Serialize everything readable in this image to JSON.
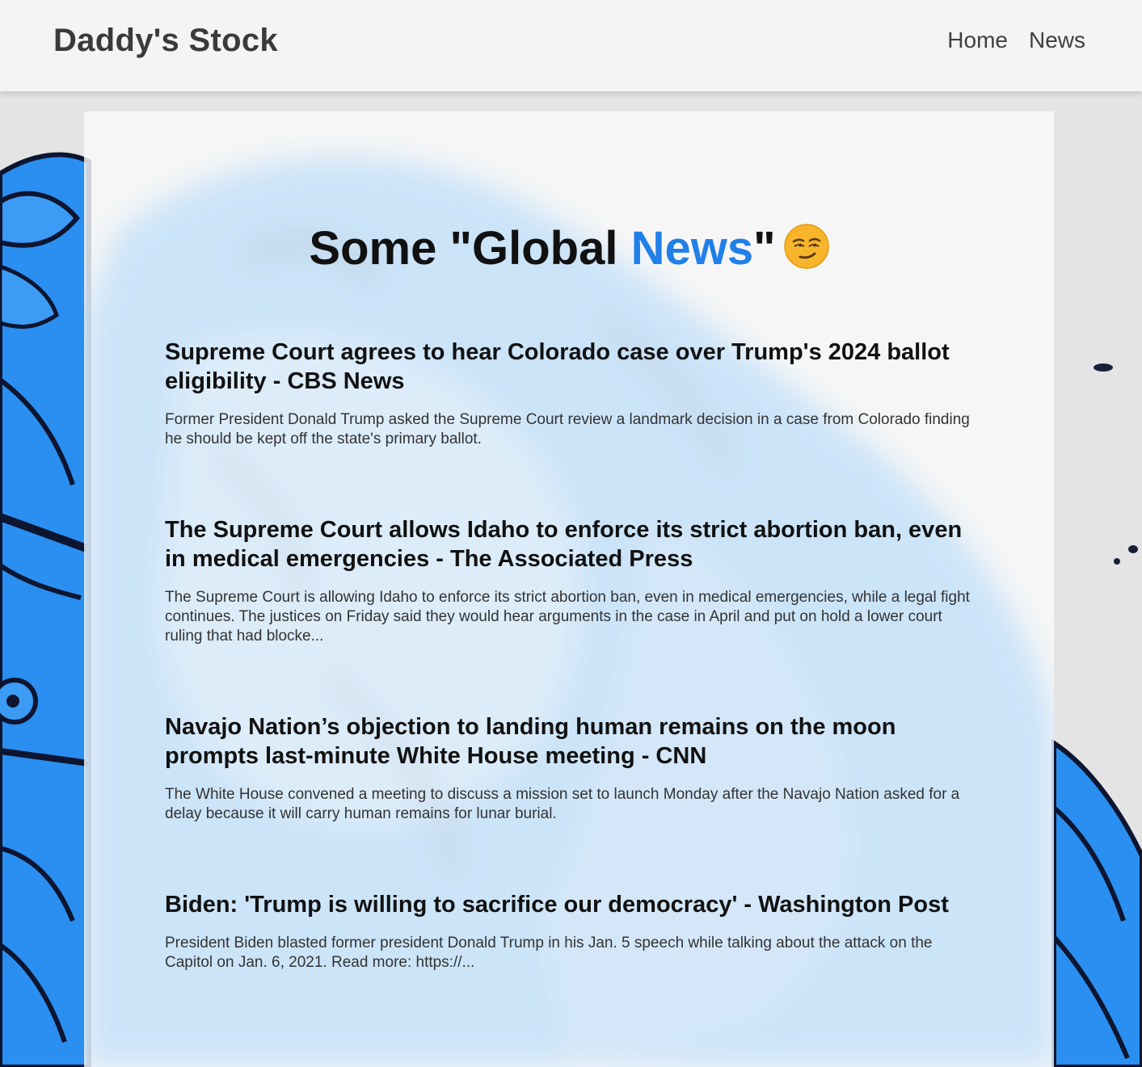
{
  "header": {
    "brand": "Daddy's Stock",
    "nav": [
      {
        "label": "Home"
      },
      {
        "label": "News"
      }
    ]
  },
  "main": {
    "title_prefix": "Some \"Global ",
    "title_accent": "News",
    "title_suffix": "\"",
    "title_emoji": "relieved-smirk-face-icon"
  },
  "news": [
    {
      "headline": "Supreme Court agrees to hear Colorado case over Trump's 2024 ballot eligibility - CBS News",
      "description": "Former President Donald Trump asked the Supreme Court review a landmark decision in a case from Colorado finding he should be kept off the state's primary ballot."
    },
    {
      "headline": "The Supreme Court allows Idaho to enforce its strict abortion ban, even in medical emergencies - The Associated Press",
      "description": "The Supreme Court is allowing Idaho to enforce its strict abortion ban, even in medical emergencies, while a legal fight continues. The justices on Friday said they would hear arguments in the case in April and put on hold a lower court ruling that had blocke..."
    },
    {
      "headline": "Navajo Nation’s objection to landing human remains on the moon prompts last-minute White House meeting - CNN",
      "description": "The White House convened a meeting to discuss a mission set to launch Monday after the Navajo Nation asked for a delay because it will carry human remains for lunar burial."
    },
    {
      "headline": "Biden: 'Trump is willing to sacrifice our democracy' - Washington Post",
      "description": "President Biden blasted former president Donald Trump in his Jan. 5 speech while talking about the attack on the Capitol on Jan. 6, 2021. Read more: https://..."
    }
  ],
  "colors": {
    "accent": "#2180e8",
    "background_art": "#2a8ff0",
    "header_bg": "#f4f4f4"
  }
}
